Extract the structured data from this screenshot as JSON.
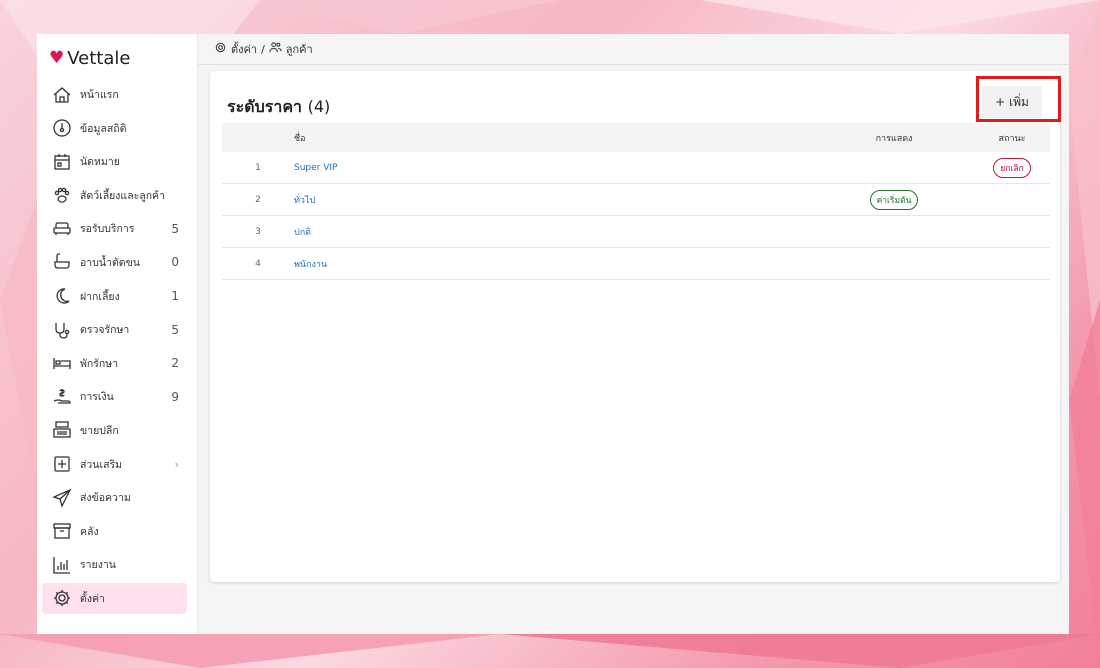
{
  "brand": {
    "name": "Vettale",
    "heart_color": "#e2145a"
  },
  "sidebar": {
    "items": [
      {
        "label": "หน้าแรก",
        "icon": "home-icon",
        "count": ""
      },
      {
        "label": "ข้อมูลสถิติ",
        "icon": "gauge-icon",
        "count": ""
      },
      {
        "label": "นัดหมาย",
        "icon": "calendar-icon",
        "count": ""
      },
      {
        "label": "สัตว์เลี้ยงและลูกค้า",
        "icon": "paw-icon",
        "count": ""
      },
      {
        "label": "รอรับบริการ",
        "icon": "sofa-icon",
        "count": "5"
      },
      {
        "label": "อาบน้ำตัดขน",
        "icon": "bathtub-icon",
        "count": "0"
      },
      {
        "label": "ฝากเลี้ยง",
        "icon": "moon-icon",
        "count": "1"
      },
      {
        "label": "ตรวจรักษา",
        "icon": "stethoscope-icon",
        "count": "5"
      },
      {
        "label": "พักรักษา",
        "icon": "bed-icon",
        "count": "2"
      },
      {
        "label": "การเงิน",
        "icon": "money-hand-icon",
        "count": "9"
      },
      {
        "label": "ขายปลีก",
        "icon": "cash-register-icon",
        "count": ""
      },
      {
        "label": "ส่วนเสริม",
        "icon": "plus-box-icon",
        "count": "",
        "chevron": "›"
      },
      {
        "label": "ส่งข้อความ",
        "icon": "paper-plane-icon",
        "count": ""
      },
      {
        "label": "คลัง",
        "icon": "archive-icon",
        "count": ""
      },
      {
        "label": "รายงาน",
        "icon": "bar-chart-icon",
        "count": ""
      },
      {
        "label": "ตั้งค่า",
        "icon": "gear-icon",
        "count": "",
        "active": true
      }
    ]
  },
  "breadcrumb": {
    "settings": "ตั้งค่า",
    "separator": "/",
    "customers": "ลูกค้า"
  },
  "card": {
    "title": "ระดับราคา",
    "count": "(4)",
    "add_label": "+ เพิ่ม"
  },
  "table": {
    "headers": {
      "name": "ชื่อ",
      "display": "การแสดง",
      "status": "สถานะ"
    },
    "rows": [
      {
        "num": "1",
        "name": "Super VIP",
        "display": "",
        "status": "ยกเลิก"
      },
      {
        "num": "2",
        "name": "ทั่วไป",
        "display": "ค่าเริ่มต้น",
        "status": ""
      },
      {
        "num": "3",
        "name": "ปกติ",
        "display": "",
        "status": ""
      },
      {
        "num": "4",
        "name": "พนักงาน",
        "display": "",
        "status": ""
      }
    ]
  },
  "colors": {
    "active_bg": "#ffe0ef",
    "link": "#1c6fb8",
    "cancel": "#c0143c",
    "default": "#1d7a2e",
    "highlight": "#e01b1b"
  }
}
